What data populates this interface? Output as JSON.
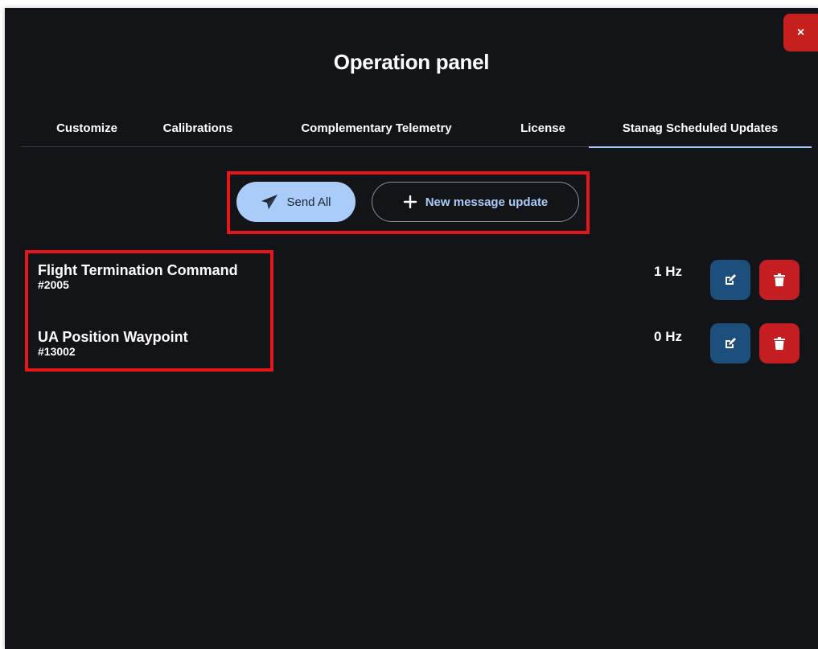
{
  "dialog": {
    "title": "Operation panel",
    "close_label": "×"
  },
  "tabs": [
    {
      "label": "Customize",
      "active": false
    },
    {
      "label": "Calibrations",
      "active": false
    },
    {
      "label": "Complementary Telemetry",
      "active": false
    },
    {
      "label": "License",
      "active": false
    },
    {
      "label": "Stanag Scheduled Updates",
      "active": true
    }
  ],
  "actions": {
    "send_all_label": "Send All",
    "new_message_label": "New message update"
  },
  "messages": [
    {
      "name": "Flight Termination Command",
      "id": "#2005",
      "frequency": "1 Hz"
    },
    {
      "name": "UA Position Waypoint",
      "id": "#13002",
      "frequency": "0 Hz"
    }
  ],
  "icons": {
    "close": "close-icon",
    "send": "paper-plane-icon",
    "add": "plus-icon",
    "edit": "edit-icon",
    "delete": "trash-icon"
  },
  "colors": {
    "background": "#121418",
    "accent": "#a9cdf8",
    "danger": "#c41e22",
    "edit": "#1d4f7c",
    "highlight": "#e5161b"
  }
}
